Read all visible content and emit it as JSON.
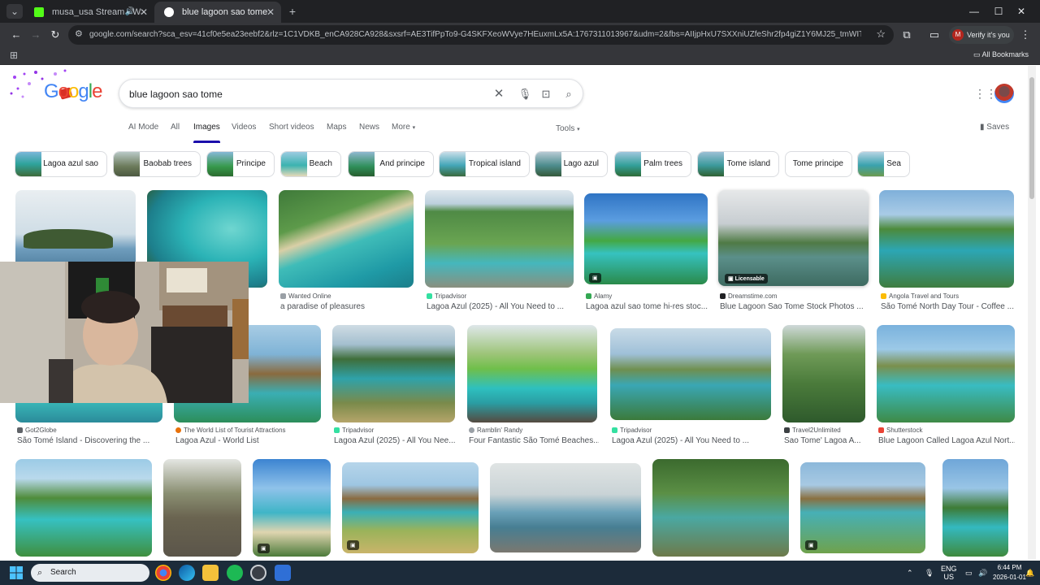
{
  "tabs": [
    {
      "title": "musa_usa Stream - Watch l",
      "favicon_color": "#53fc18",
      "active": false
    },
    {
      "title": "blue lagoon sao tome - Googl",
      "favicon_color": "#4285f4",
      "active": true
    }
  ],
  "window": {
    "minimize": "—",
    "maximize": "☐",
    "close": "✕"
  },
  "toolbar": {
    "url": "google.com/search?sca_esv=41cf0e5ea23eebf2&rlz=1C1VDKB_enCA928CA928&sxsrf=AE3TifPpTo9-G4SKFXeoWVye7HEuxmLx5A:1767311013967&udm=2&fbs=AIIjpHxU7SXXniUZfeShr2fp4giZ1Y6MJ25_tmWITc7uy4KIeoJTKjrFjVxyd...",
    "verify_label": "Verify it's you",
    "verify_avatar": "M"
  },
  "bookmarks": {
    "all_label": "All Bookmarks"
  },
  "google": {
    "query": "blue lagoon sao tome",
    "nav_tabs": [
      "AI Mode",
      "All",
      "Images",
      "Videos",
      "Short videos",
      "Maps",
      "News",
      "More"
    ],
    "active_tab": "Images",
    "tools_label": "Tools",
    "saves_label": "Saves",
    "chips": [
      "Lagoa azul sao",
      "Baobab trees",
      "Principe",
      "Beach",
      "And principe",
      "Tropical island",
      "Lago azul",
      "Palm trees",
      "Tome island",
      "Tome principe",
      "Sea"
    ],
    "results_row1": [
      {
        "source": "",
        "caption": ""
      },
      {
        "source": "",
        "caption": ""
      },
      {
        "source": "Wanted Online",
        "caption": "a paradise of pleasures"
      },
      {
        "source": "Tripadvisor",
        "caption": "Lagoa Azul (2025) - All You Need to ..."
      },
      {
        "source": "Alamy",
        "caption": "Lagoa azul sao tome hi-res stoc..."
      },
      {
        "source": "Dreamstime.com",
        "caption": "Blue Lagoon Sao Tome Stock Photos ...",
        "badge": "Licensable"
      },
      {
        "source": "Angola Travel and Tours",
        "caption": "São Tomé North Day Tour - Coffee ..."
      }
    ],
    "results_row2": [
      {
        "source": "Got2Globe",
        "caption": "São Tomé Island - Discovering the ..."
      },
      {
        "source": "The World List of Tourist Attractions",
        "caption": "Lagoa Azul - World List"
      },
      {
        "source": "Tripadvisor",
        "caption": "Lagoa Azul (2025) - All You Nee..."
      },
      {
        "source": "Ramblin' Randy",
        "caption": "Four Fantastic São Tomé Beaches..."
      },
      {
        "source": "Tripadvisor",
        "caption": "Lagoa Azul (2025) - All You Need to ..."
      },
      {
        "source": "Travel2Unlimited",
        "caption": "Sao Tome' Lagoa A..."
      },
      {
        "source": "Shutterstock",
        "caption": "Blue Lagoon Called Lagoa Azul Nort..."
      }
    ]
  },
  "taskbar": {
    "search_label": "Search",
    "lang": "ENG",
    "region": "US",
    "time": "6:44 PM",
    "date": "2026-01-01"
  }
}
